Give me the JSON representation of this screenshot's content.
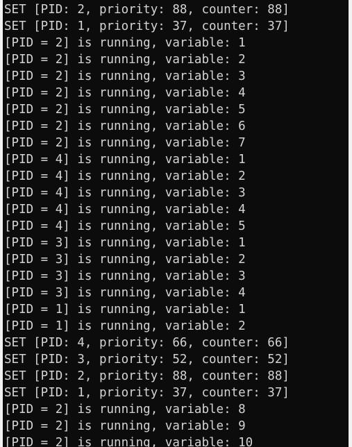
{
  "terminal": {
    "lines": [
      "SET [PID: 2, priority: 88, counter: 88]",
      "SET [PID: 1, priority: 37, counter: 37]",
      "[PID = 2] is running, variable: 1",
      "[PID = 2] is running, variable: 2",
      "[PID = 2] is running, variable: 3",
      "[PID = 2] is running, variable: 4",
      "[PID = 2] is running, variable: 5",
      "[PID = 2] is running, variable: 6",
      "[PID = 2] is running, variable: 7",
      "[PID = 4] is running, variable: 1",
      "[PID = 4] is running, variable: 2",
      "[PID = 4] is running, variable: 3",
      "[PID = 4] is running, variable: 4",
      "[PID = 4] is running, variable: 5",
      "[PID = 3] is running, variable: 1",
      "[PID = 3] is running, variable: 2",
      "[PID = 3] is running, variable: 3",
      "[PID = 3] is running, variable: 4",
      "[PID = 1] is running, variable: 1",
      "[PID = 1] is running, variable: 2",
      "SET [PID: 4, priority: 66, counter: 66]",
      "SET [PID: 3, priority: 52, counter: 52]",
      "SET [PID: 2, priority: 88, counter: 88]",
      "SET [PID: 1, priority: 37, counter: 37]",
      "[PID = 2] is running, variable: 8",
      "[PID = 2] is running, variable: 9",
      "[PID = 2] is running, variable: 10"
    ]
  },
  "colors": {
    "background": "#0c0c0c",
    "text": "#d4d4d4"
  }
}
